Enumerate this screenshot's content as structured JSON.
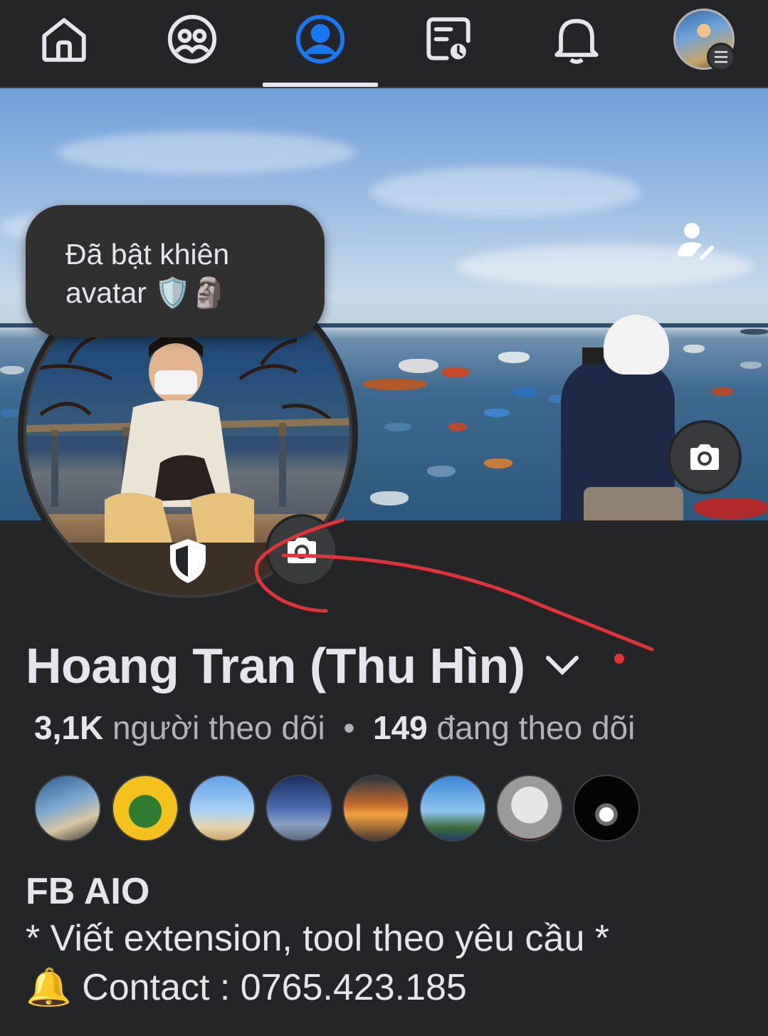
{
  "nav": {
    "items": [
      {
        "name": "home",
        "icon": "home-icon",
        "active": false
      },
      {
        "name": "friends",
        "icon": "friends-icon",
        "active": false
      },
      {
        "name": "profile",
        "icon": "profile-icon",
        "active": true
      },
      {
        "name": "feeds",
        "icon": "feeds-icon",
        "active": false
      },
      {
        "name": "notifications",
        "icon": "bell-icon",
        "active": false
      },
      {
        "name": "menu",
        "icon": "menu-avatar",
        "active": false
      }
    ],
    "active_color": "#1877f2"
  },
  "cover": {
    "edit_icon": "edit-profile-icon",
    "camera_icon": "camera-icon"
  },
  "tooltip": {
    "text": "Đã bật khiên avatar 🛡️🗿"
  },
  "profile": {
    "name": "Hoang Tran (Thu Hìn)",
    "followers_count": "3,1K",
    "followers_label": "người theo dõi",
    "separator": "•",
    "following_count": "149",
    "following_label": "đang theo dõi"
  },
  "bio": {
    "title": "FB AIO",
    "line1": "* Viết extension, tool theo yêu cầu *",
    "line2": "🔔 Contact : 0765.423.185"
  },
  "colors": {
    "background": "#242526",
    "text": "#e4e6eb",
    "muted": "#b0b3b8",
    "annotation": "#e0343a"
  }
}
